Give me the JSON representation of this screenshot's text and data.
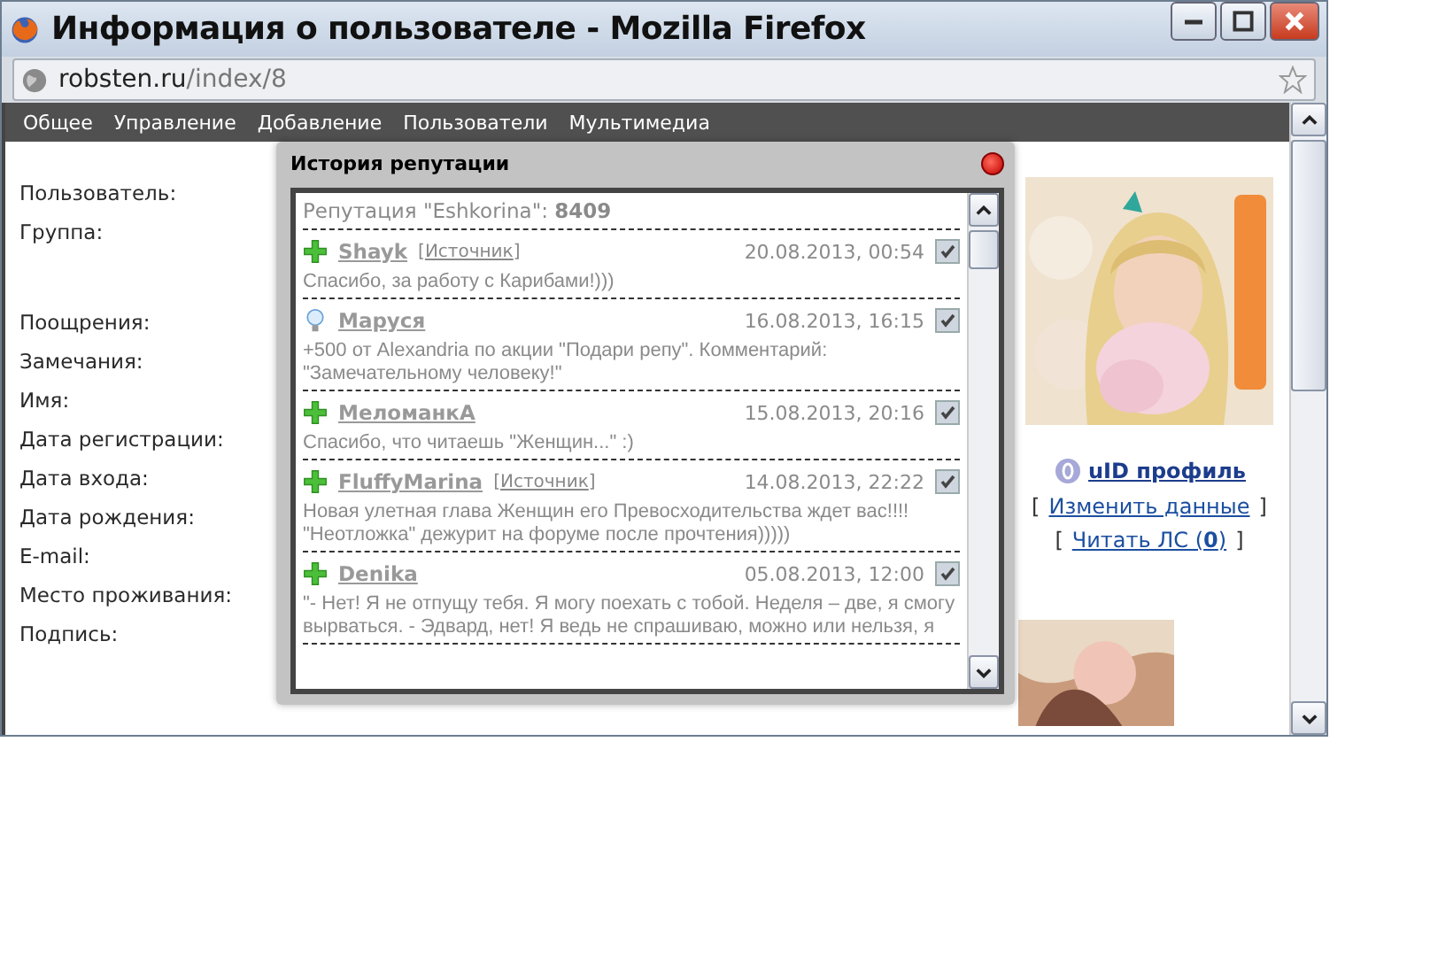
{
  "window": {
    "title": "Информация о пользователе - Mozilla Firefox"
  },
  "address": {
    "domain": "robsten.ru",
    "path": "/index/8"
  },
  "menu": [
    "Общее",
    "Управление",
    "Добавление",
    "Пользователи",
    "Мультимедиа"
  ],
  "fields": [
    {
      "label": "Пользователь:",
      "gap_before": false
    },
    {
      "label": "Группа:",
      "gap_before": false
    },
    {
      "label": "Поощрения:",
      "gap_before": true
    },
    {
      "label": "Замечания:",
      "gap_before": false
    },
    {
      "label": "Имя:",
      "gap_before": false
    },
    {
      "label": "Дата регистрации:",
      "gap_before": false
    },
    {
      "label": "Дата входа:",
      "gap_before": false
    },
    {
      "label": "Дата рождения:",
      "gap_before": false
    },
    {
      "label": "E-mail:",
      "gap_before": false
    },
    {
      "label": "Место проживания:",
      "gap_before": false
    },
    {
      "label": "Подпись:",
      "gap_before": false
    }
  ],
  "profile": {
    "uid_link": "uID профиль",
    "links": [
      {
        "open": "[",
        "link": "Изменить данные",
        "close": "]"
      },
      {
        "open": "[",
        "link": "Читать ЛС (**0**)",
        "close": "]"
      }
    ]
  },
  "popup": {
    "title": "История репутации",
    "summary": "Репутация \"Eshkorina\": **8409**",
    "entries": [
      {
        "kind": "plus",
        "user": "Shayk",
        "source": {
          "open": "[",
          "link": "Источник",
          "close": "]"
        },
        "date": "20.08.2013, 00:54",
        "checked": true,
        "comment": "Спасибо, за работу с Карибами!)))"
      },
      {
        "kind": "bulb",
        "user": "Маруся",
        "date": "16.08.2013, 16:15",
        "checked": true,
        "comment": "+500 от Alexandria по акции \"Подари репу\". Комментарий: \"Замечательному человеку!\""
      },
      {
        "kind": "plus",
        "user": "МеломанкА",
        "date": "15.08.2013, 20:16",
        "checked": true,
        "comment": "Спасибо, что читаешь \"Женщин...\" :)"
      },
      {
        "kind": "plus",
        "user": "FluffyMarina",
        "source": {
          "open": "[",
          "link": "Источник",
          "close": "]"
        },
        "date": "14.08.2013, 22:22",
        "checked": true,
        "comment": "Новая улетная глава Женщин его Превосходительства ждет вас!!!! \"Неотложка\" дежурит на форуме после прочтения)))))"
      },
      {
        "kind": "plus",
        "user": "Denika",
        "date": "05.08.2013, 12:00",
        "checked": true,
        "comment": "\"- Нет! Я не отпущу тебя. Я могу поехать с тобой. Неделя – две, я смогу вырваться. - Эдвард, нет! Я ведь не спрашиваю, можно или нельзя, я"
      }
    ]
  }
}
